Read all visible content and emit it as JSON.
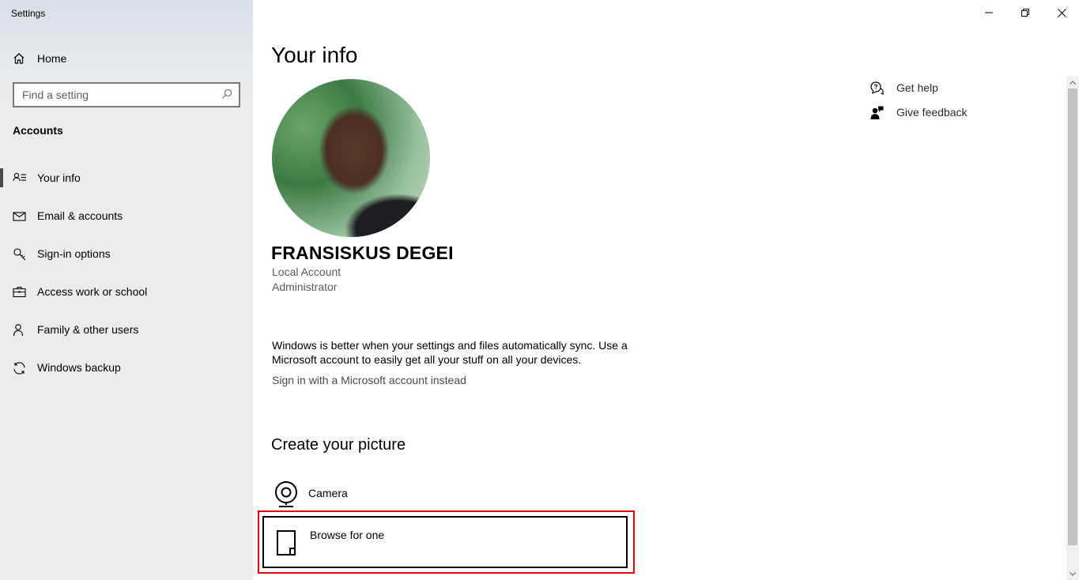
{
  "window": {
    "title": "Settings"
  },
  "sidebar": {
    "home_label": "Home",
    "search_placeholder": "Find a setting",
    "section_title": "Accounts",
    "items": [
      {
        "label": "Your info",
        "icon": "person-list-icon",
        "active": true
      },
      {
        "label": "Email & accounts",
        "icon": "mail-icon"
      },
      {
        "label": "Sign-in options",
        "icon": "key-icon"
      },
      {
        "label": "Access work or school",
        "icon": "briefcase-icon"
      },
      {
        "label": "Family & other users",
        "icon": "person-add-icon"
      },
      {
        "label": "Windows backup",
        "icon": "sync-icon"
      }
    ]
  },
  "main": {
    "title": "Your info",
    "user": {
      "name": "FRANSISKUS DEGEI",
      "account_type": "Local Account",
      "role": "Administrator"
    },
    "sync_message": "Windows is better when your settings and files automatically sync. Use a Microsoft account to easily get all your stuff on all your devices.",
    "ms_link": "Sign in with a Microsoft account instead",
    "create_picture": {
      "title": "Create your picture",
      "options": [
        {
          "label": "Camera",
          "icon": "camera-icon"
        },
        {
          "label": "Browse for one",
          "icon": "file-icon"
        }
      ]
    }
  },
  "help": {
    "get_help": "Get help",
    "give_feedback": "Give feedback"
  },
  "colors": {
    "highlight": "#e3000b",
    "active_indicator": "#4a4a4a"
  }
}
